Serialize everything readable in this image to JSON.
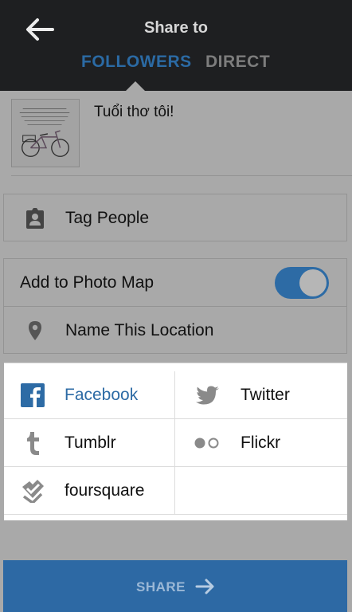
{
  "header": {
    "title": "Share to",
    "tabs": [
      {
        "label": "FOLLOWERS",
        "active": true
      },
      {
        "label": "DIRECT",
        "active": false
      }
    ]
  },
  "post": {
    "caption": "Tuổi thơ tôi!"
  },
  "options": {
    "tag_people": "Tag People",
    "add_to_photo_map": "Add to Photo Map",
    "photo_map_enabled": true,
    "name_location": "Name This Location"
  },
  "share_targets": [
    {
      "label": "Facebook",
      "icon": "facebook-icon",
      "active": true
    },
    {
      "label": "Twitter",
      "icon": "twitter-icon",
      "active": false
    },
    {
      "label": "Tumblr",
      "icon": "tumblr-icon",
      "active": false
    },
    {
      "label": "Flickr",
      "icon": "flickr-icon",
      "active": false
    },
    {
      "label": "foursquare",
      "icon": "foursquare-icon",
      "active": false
    }
  ],
  "share_button": {
    "label": "SHARE"
  },
  "colors": {
    "accent": "#2d6ba5",
    "header_bg": "#1e1f21",
    "dim_bg": "#a9a9a9"
  }
}
